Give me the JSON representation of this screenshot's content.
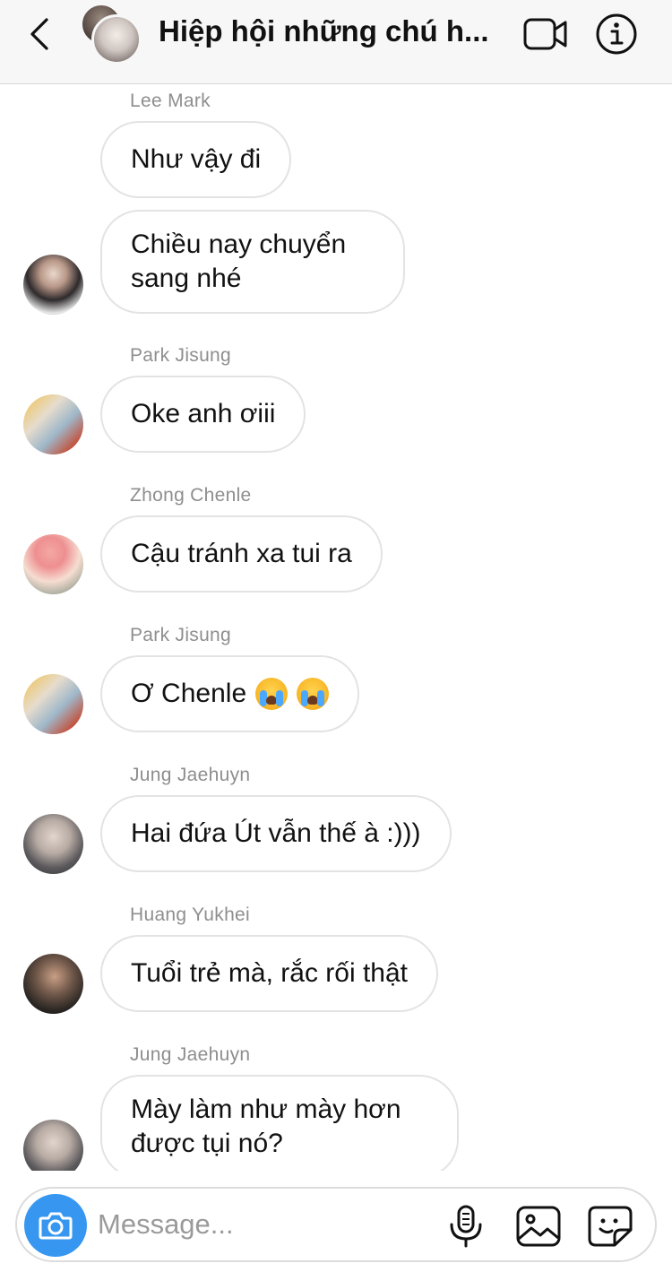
{
  "header": {
    "title": "Hiệp hội những chú h...",
    "back_icon": "chevron-left-icon",
    "video_icon": "video-camera-icon",
    "info_icon": "info-icon"
  },
  "messages": [
    {
      "sender": "Lee Mark",
      "text": "Như vậy đi",
      "avatar": false
    },
    {
      "sender": "",
      "text": "Chiều nay chuyển sang nhé",
      "avatar": true
    },
    {
      "sender": "Park Jisung",
      "text": "Oke anh ơiii",
      "avatar": true
    },
    {
      "sender": "Zhong Chenle",
      "text": "Cậu tránh xa tui ra",
      "avatar": true
    },
    {
      "sender": "Park Jisung",
      "text": "Ơ Chenle",
      "emoji": "loudly-crying-face-emoji x2",
      "avatar": true
    },
    {
      "sender": "Jung Jaehuyn",
      "text": "Hai đứa Út vẫn thế à :)))",
      "avatar": true
    },
    {
      "sender": "Huang Yukhei",
      "text": "Tuổi trẻ mà, rắc rối thật",
      "avatar": true
    },
    {
      "sender": "Jung Jaehuyn",
      "text": "Mày làm như mày hơn được tụi nó?",
      "avatar": true
    }
  ],
  "composer": {
    "placeholder": "Message...",
    "camera_icon": "camera-icon",
    "mic_icon": "microphone-icon",
    "gallery_icon": "image-gallery-icon",
    "sticker_icon": "sticker-icon"
  },
  "colors": {
    "accent": "#3797f0",
    "sender_text": "#8e8e8e",
    "bubble_border": "#e3e3e3",
    "header_bg": "#f7f7f7"
  }
}
